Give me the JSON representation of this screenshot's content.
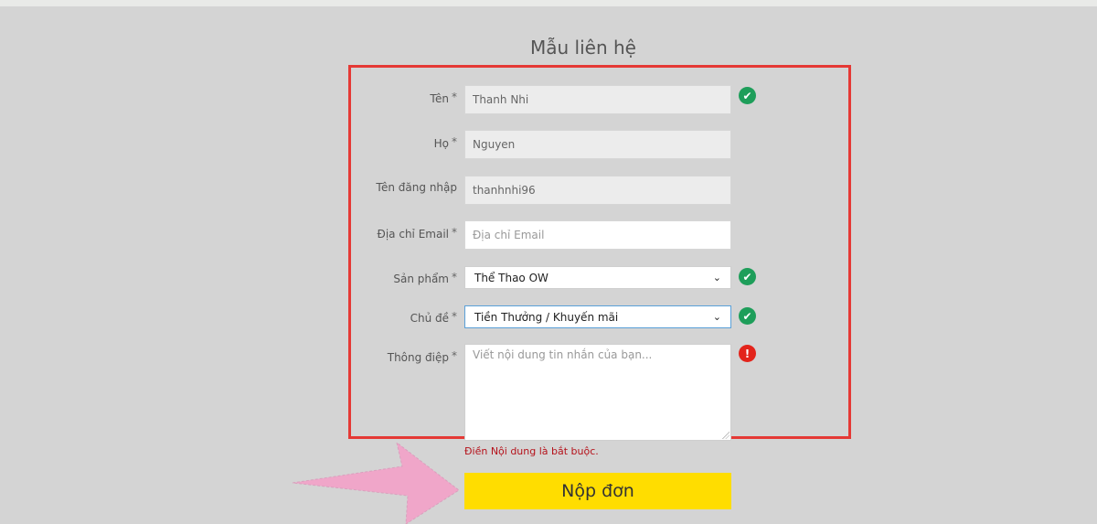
{
  "form": {
    "title": "Mẫu liên hệ",
    "required_mark": "*",
    "fields": {
      "first_name": {
        "label": "Tên",
        "value": "Thanh Nhi"
      },
      "last_name": {
        "label": "Họ",
        "value": "Nguyen"
      },
      "username": {
        "label": "Tên đăng nhập",
        "value": "thanhnhi96"
      },
      "email": {
        "label": "Địa chỉ Email",
        "value": "",
        "placeholder": "Địa chỉ Email"
      },
      "product": {
        "label": "Sản phẩm",
        "selected": "Thể Thao OW"
      },
      "topic": {
        "label": "Chủ đề",
        "selected": "Tiền Thưởng / Khuyến mãi"
      },
      "message": {
        "label": "Thông điệp",
        "value": "",
        "placeholder": "Viết nội dung tin nhắn của bạn..."
      }
    },
    "validation": {
      "message_error": "Điền Nội dung là bắt buộc.",
      "ok_symbol": "✔",
      "error_symbol": "!"
    },
    "submit_label": "Nộp đơn"
  },
  "colors": {
    "highlight_border": "#e53935",
    "submit_bg": "#ffdd00",
    "ok": "#1e9e5a",
    "error": "#e3241b",
    "arrow": "#f0a6c9"
  }
}
